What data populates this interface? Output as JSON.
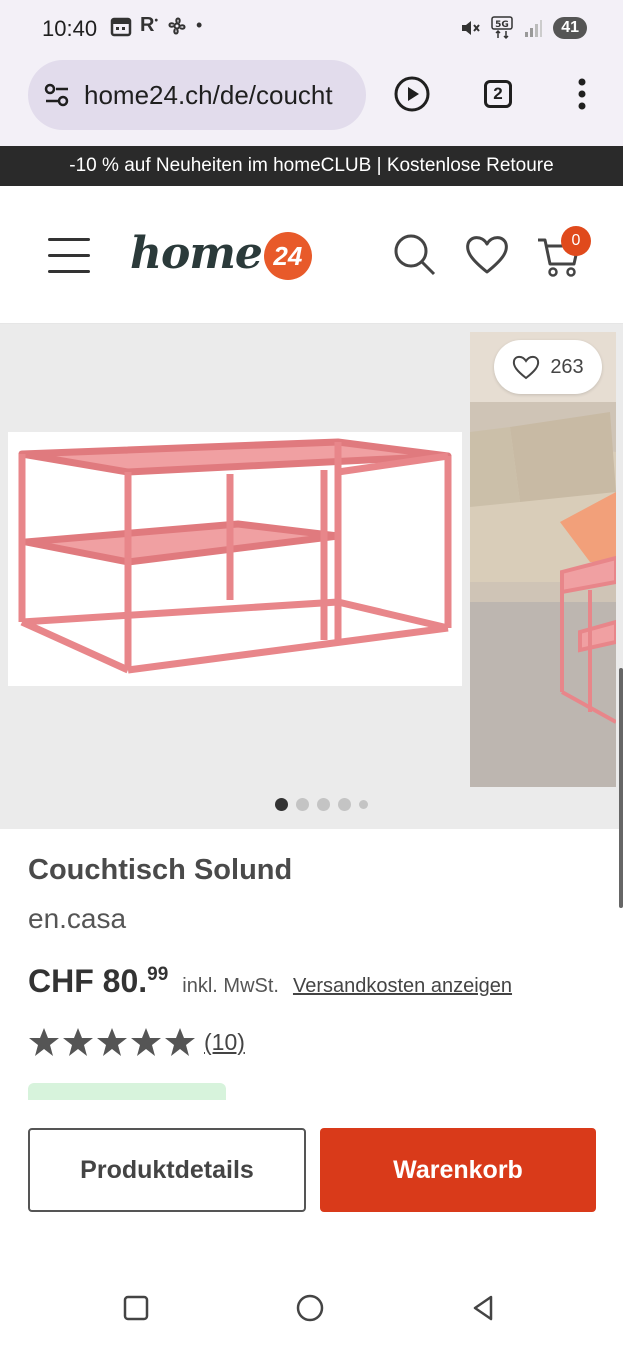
{
  "status_bar": {
    "time": "10:40",
    "left_icons": [
      "calendar-icon",
      "r-icon",
      "fan-icon",
      "dot-icon"
    ],
    "right_icons": [
      "mute-icon",
      "5g-icon",
      "signal-icon"
    ],
    "battery": "41"
  },
  "browser": {
    "url": "home24.ch/de/coucht",
    "tab_count": "2"
  },
  "promo": {
    "text": "-10 % auf Neuheiten im homeCLUB | Kostenlose Retoure"
  },
  "header": {
    "logo_word": "home",
    "logo_number": "24",
    "cart_count": "0"
  },
  "gallery": {
    "favorite_count": "263",
    "dot_count": 5,
    "active_dot": 0
  },
  "product": {
    "title": "Couchtisch Solund",
    "brand": "en.casa",
    "price_main": "CHF 80.",
    "price_cents": "99",
    "vat": "inkl. MwSt.",
    "shipping_link": "Versandkosten anzeigen",
    "rating": 5,
    "review_count": "(10)"
  },
  "actions": {
    "details_label": "Produktdetails",
    "cart_label": "Warenkorb"
  },
  "colors": {
    "accent": "#d93a1a",
    "logo_orange": "#e85a2a",
    "promo_bg": "#2a2a2a",
    "table_pink": "#e8868a"
  }
}
